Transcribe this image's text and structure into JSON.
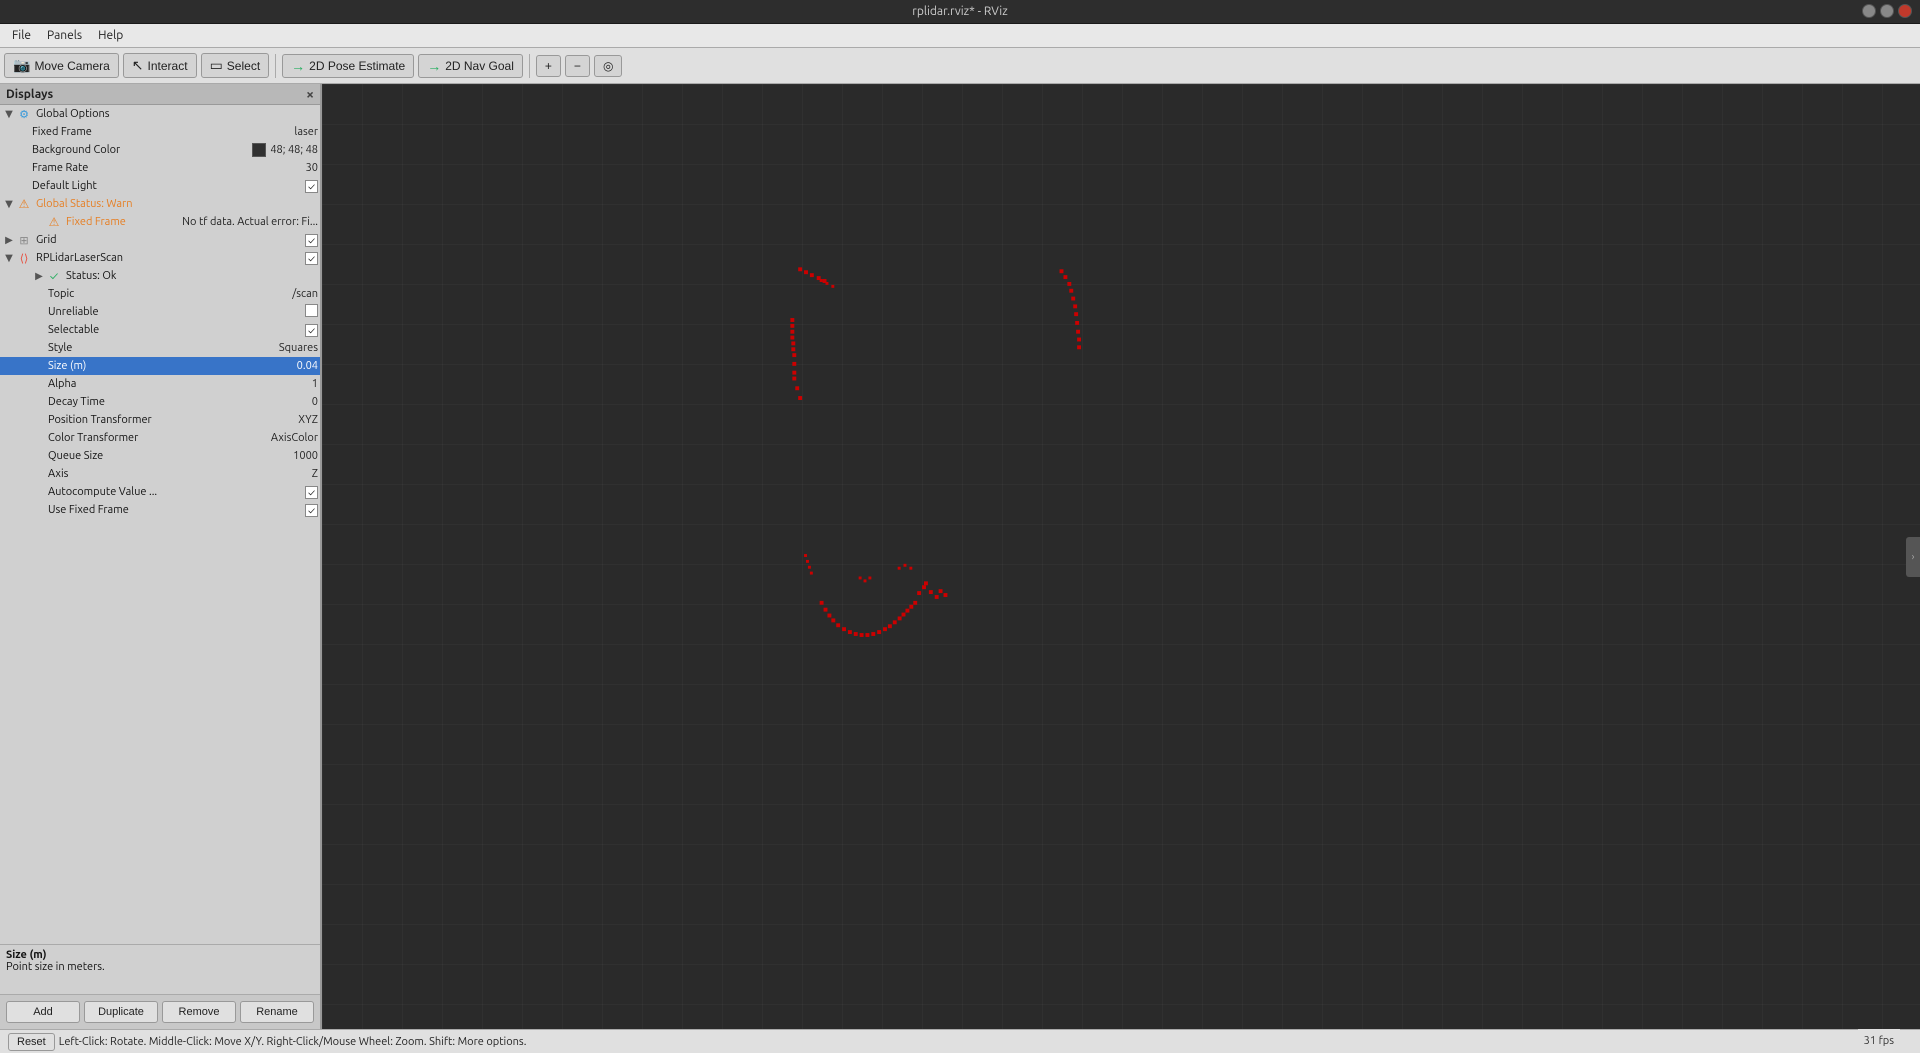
{
  "window": {
    "title": "rplidar.rviz* - RViz"
  },
  "menubar": {
    "file": "File",
    "panels": "Panels",
    "help": "Help"
  },
  "toolbar": {
    "move_camera": "Move Camera",
    "interact": "Interact",
    "select": "Select",
    "pose_estimate": "2D Pose Estimate",
    "nav_goal": "2D Nav Goal",
    "icons": {
      "plus": "+",
      "minus": "−",
      "target": "◎"
    }
  },
  "displays_panel": {
    "title": "Displays",
    "close_label": "×"
  },
  "tree": {
    "global_options": {
      "label": "Global Options",
      "fixed_frame_label": "Fixed Frame",
      "fixed_frame_value": "laser",
      "bg_color_label": "Background Color",
      "bg_color_value": "48; 48; 48",
      "frame_rate_label": "Frame Rate",
      "frame_rate_value": "30",
      "default_light_label": "Default Light",
      "default_light_value": "✓"
    },
    "global_status": {
      "label": "Global Status: Warn",
      "fixed_frame_label": "Fixed Frame",
      "fixed_frame_value": "No tf data. Actual error: Fi..."
    },
    "grid": {
      "label": "Grid",
      "checked": true
    },
    "rplidar": {
      "label": "RPLidarLaserScan",
      "checked": true,
      "status_label": "Status: Ok",
      "topic_label": "Topic",
      "topic_value": "/scan",
      "unreliable_label": "Unreliable",
      "unreliable_value": false,
      "selectable_label": "Selectable",
      "selectable_value": true,
      "style_label": "Style",
      "style_value": "Squares",
      "size_label": "Size (m)",
      "size_value": "0.04",
      "alpha_label": "Alpha",
      "alpha_value": "1",
      "decay_time_label": "Decay Time",
      "decay_time_value": "0",
      "position_transformer_label": "Position Transformer",
      "position_transformer_value": "XYZ",
      "color_transformer_label": "Color Transformer",
      "color_transformer_value": "AxisColor",
      "queue_size_label": "Queue Size",
      "queue_size_value": "1000",
      "axis_label": "Axis",
      "axis_value": "Z",
      "autocompute_label": "Autocompute Value ...",
      "autocompute_value": true,
      "use_fixed_frame_label": "Use Fixed Frame",
      "use_fixed_frame_value": true
    }
  },
  "status_area": {
    "title": "Size (m)",
    "description": "Point size in meters."
  },
  "buttons": {
    "add": "Add",
    "duplicate": "Duplicate",
    "remove": "Remove",
    "rename": "Rename"
  },
  "statusbar": {
    "reset": "Reset",
    "hint": "Left-Click: Rotate.  Middle-Click: Move X/Y.  Right-Click/Mouse Wheel: Zoom.  Shift: More options."
  },
  "fps": "31 fps"
}
